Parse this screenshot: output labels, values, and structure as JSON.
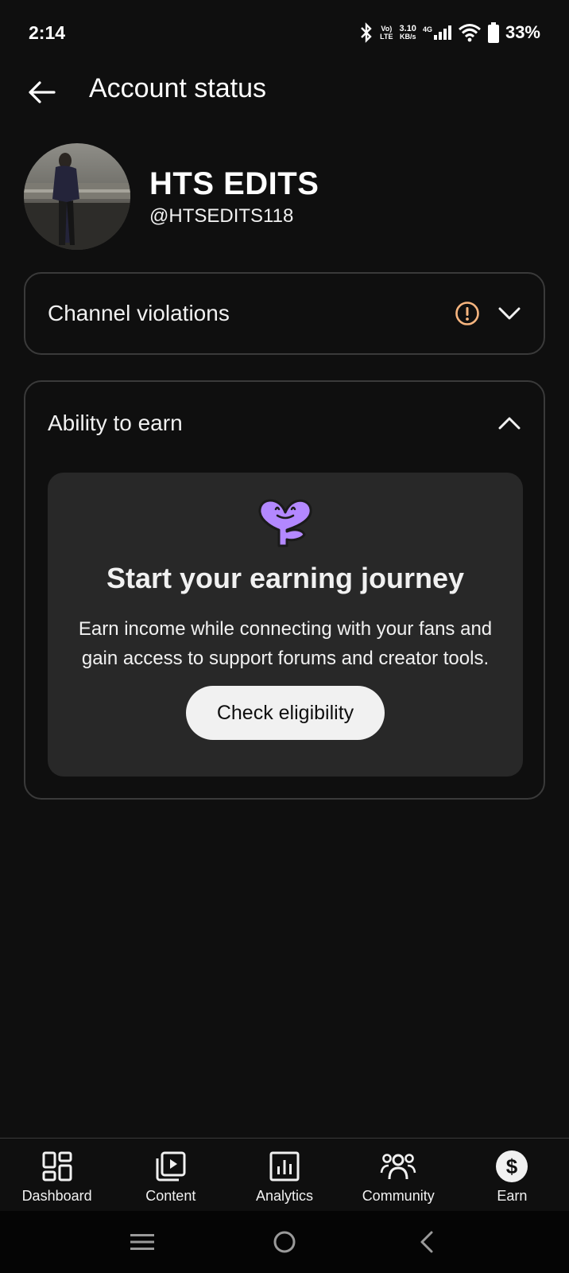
{
  "status_bar": {
    "time": "2:14",
    "volte": "Vo)",
    "lte": "LTE",
    "speed": "3.10",
    "speed_unit": "KB/s",
    "network": "4G",
    "battery": "33%"
  },
  "header": {
    "title": "Account status"
  },
  "profile": {
    "name": "HTS EDITS",
    "handle": "@HTSEDITS118"
  },
  "violations": {
    "label": "Channel violations",
    "warning_color": "#f7b57f"
  },
  "earn": {
    "label": "Ability to earn",
    "title": "Start your earning journey",
    "description": "Earn income while connecting with your fans and gain access to support forums and creator tools.",
    "button_label": "Check eligibility",
    "mascot_color": "#b388ff"
  },
  "nav": {
    "items": [
      {
        "label": "Dashboard",
        "icon": "dashboard-icon"
      },
      {
        "label": "Content",
        "icon": "content-icon"
      },
      {
        "label": "Analytics",
        "icon": "analytics-icon"
      },
      {
        "label": "Community",
        "icon": "community-icon"
      },
      {
        "label": "Earn",
        "icon": "earn-icon"
      }
    ]
  }
}
